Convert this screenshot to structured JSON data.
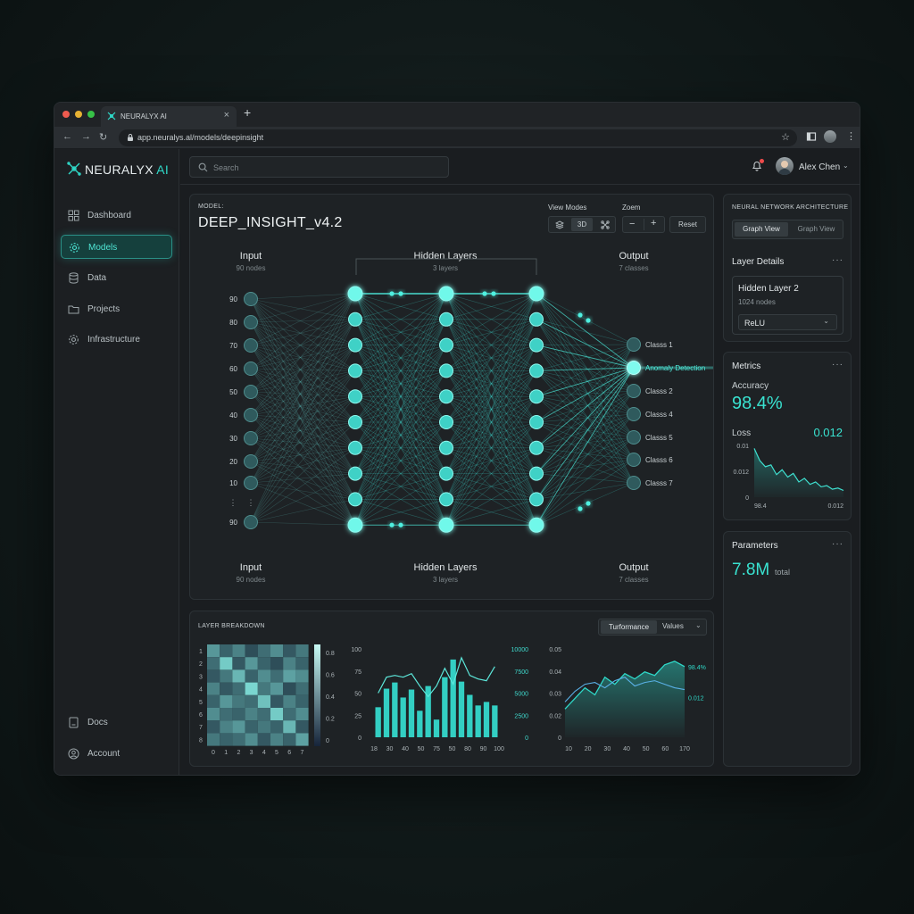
{
  "browser": {
    "tab_title": "NEURALYX AI",
    "tab_close": "×",
    "new_tab": "+",
    "url": "app.neuralys.al/models/deepinsight"
  },
  "sidebar": {
    "logo_main": "NEURALYX",
    "logo_ai": "AI",
    "items": [
      {
        "label": "Dashboard",
        "icon": "grid-icon"
      },
      {
        "label": "Models",
        "icon": "gear-icon",
        "active": true
      },
      {
        "label": "Data",
        "icon": "database-icon"
      },
      {
        "label": "Projects",
        "icon": "folder-icon"
      },
      {
        "label": "Infrastructure",
        "icon": "cog-icon"
      }
    ],
    "bottom_items": [
      {
        "label": "Docs",
        "icon": "doc-icon"
      },
      {
        "label": "Account",
        "icon": "user-icon"
      }
    ]
  },
  "header": {
    "search_placeholder": "Search",
    "user_name": "Alex Chen"
  },
  "model_panel": {
    "model_caption": "MODEL:",
    "model_name": "DEEP_INSIGHT_v4.2",
    "view_modes_label": "View Modes",
    "view_mode_3d": "3D",
    "zoom_label": "Zoem",
    "zoom_minus": "−",
    "zoom_plus": "+",
    "reset_label": "Reset",
    "top_labels": {
      "input": "Input",
      "input_sub": "90 nodes",
      "hidden": "Hidden Layers",
      "hidden_sub": "3 layers",
      "output": "Output",
      "output_sub": "7 classes"
    },
    "bottom_labels": {
      "input": "Input",
      "input_sub": "90 nodes",
      "hidden": "Hidden Layers",
      "hidden_sub": "3 layers",
      "output": "Output",
      "output_sub": "7 classes"
    },
    "input_values": [
      "90",
      "80",
      "70",
      "60",
      "50",
      "40",
      "30",
      "20",
      "10",
      "⋮",
      "90"
    ],
    "output_classes": [
      "Classs 1",
      "Anomaly Detection",
      "Classs 2",
      "Classs 4",
      "Classs 5",
      "Classs 6",
      "Classs 7"
    ],
    "highlight_color": "#4ff0e0"
  },
  "architecture_panel": {
    "title": "NEURAL NETWORK ARCHITECTURE",
    "view_tabs": [
      "Graph View",
      "Graph View"
    ],
    "layer_details_title": "Layer Details",
    "layer_name": "Hidden Layer 2",
    "layer_nodes": "1024 nodes",
    "activation": "ReLU"
  },
  "metrics_panel": {
    "title": "Metrics",
    "accuracy_label": "Accuracy",
    "accuracy_value": "98.4%",
    "loss_label": "Loss",
    "loss_value": "0.012",
    "chart_y_ticks": [
      "0.01",
      "0.012",
      "0"
    ],
    "chart_x_ticks": [
      "98.4",
      "0.012"
    ]
  },
  "parameters_panel": {
    "title": "Parameters",
    "value": "7.8M",
    "unit": "total"
  },
  "layer_breakdown": {
    "title": "LAYER BREAKDOWN",
    "toggle": [
      "Turformance",
      "Values"
    ],
    "heatmap": {
      "row_labels": [
        "1",
        "2",
        "3",
        "4",
        "5",
        "6",
        "7",
        "8"
      ],
      "col_labels": [
        "0",
        "1",
        "2",
        "3",
        "4",
        "5",
        "6",
        "7"
      ],
      "scale_ticks": [
        "0.8",
        "0.6",
        "0.4",
        "0.2",
        "0"
      ],
      "values": [
        [
          0.55,
          0.3,
          0.45,
          0.2,
          0.35,
          0.5,
          0.25,
          0.4
        ],
        [
          0.35,
          0.8,
          0.25,
          0.55,
          0.3,
          0.2,
          0.45,
          0.3
        ],
        [
          0.25,
          0.4,
          0.7,
          0.3,
          0.5,
          0.35,
          0.6,
          0.5
        ],
        [
          0.45,
          0.25,
          0.35,
          0.85,
          0.4,
          0.55,
          0.2,
          0.35
        ],
        [
          0.3,
          0.55,
          0.4,
          0.35,
          0.75,
          0.25,
          0.45,
          0.3
        ],
        [
          0.5,
          0.35,
          0.3,
          0.45,
          0.35,
          0.8,
          0.35,
          0.5
        ],
        [
          0.25,
          0.45,
          0.55,
          0.3,
          0.4,
          0.3,
          0.7,
          0.25
        ],
        [
          0.4,
          0.3,
          0.35,
          0.5,
          0.25,
          0.45,
          0.3,
          0.6
        ]
      ]
    }
  },
  "chart_data": [
    {
      "type": "bar",
      "title": "",
      "x_ticks": [
        "18",
        "30",
        "40",
        "50",
        "75",
        "50",
        "80",
        "90",
        "100"
      ],
      "y_left_ticks": [
        "100",
        "75",
        "50",
        "25",
        "0"
      ],
      "y_right_ticks": [
        "10000",
        "7500",
        "5000",
        "2500",
        "0"
      ],
      "ylim": [
        0,
        100
      ],
      "bars": [
        34,
        55,
        62,
        45,
        54,
        30,
        58,
        20,
        68,
        88,
        63,
        48,
        36,
        40,
        36
      ],
      "line": [
        50,
        68,
        70,
        68,
        72,
        58,
        46,
        58,
        78,
        60,
        90,
        70,
        66,
        64,
        80
      ]
    },
    {
      "type": "area",
      "title": "",
      "x_ticks": [
        "10",
        "20",
        "30",
        "40",
        "50",
        "60",
        "170"
      ],
      "y_ticks": [
        "0.05",
        "0.04",
        "0.03",
        "0.02",
        "0"
      ],
      "ylim": [
        0,
        0.05
      ],
      "series": [
        {
          "name": "98.4%",
          "values": [
            0.016,
            0.022,
            0.028,
            0.024,
            0.034,
            0.03,
            0.036,
            0.033,
            0.037,
            0.035,
            0.041,
            0.043,
            0.04
          ]
        },
        {
          "name": "0.012",
          "values": [
            0.02,
            0.026,
            0.03,
            0.031,
            0.028,
            0.032,
            0.034,
            0.029,
            0.031,
            0.032,
            0.03,
            0.028,
            0.027
          ]
        }
      ],
      "series_labels": [
        "98.4%",
        "0.012"
      ]
    },
    {
      "type": "line",
      "title": "",
      "y_ticks": [
        "0.01",
        "0.012",
        "0"
      ],
      "x_ticks": [
        "98.4",
        "0.012"
      ],
      "values": [
        0.0125,
        0.0105,
        0.0095,
        0.0098,
        0.0082,
        0.009,
        0.0078,
        0.0084,
        0.007,
        0.0076,
        0.0066,
        0.007,
        0.0062,
        0.0064,
        0.0058,
        0.006,
        0.0056
      ]
    }
  ]
}
